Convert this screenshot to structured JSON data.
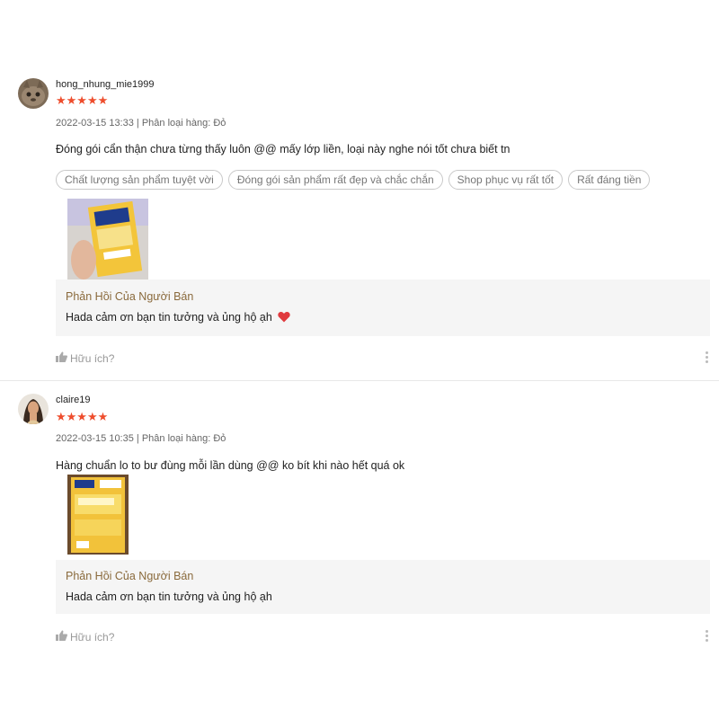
{
  "reviews": [
    {
      "username": "hong_nhung_mie1999",
      "stars": "★★★★★",
      "rating": 5,
      "meta": "2022-03-15 13:33 | Phân loại hàng: Đỏ",
      "comment": "Đóng gói cẩn thận chưa từng thấy luôn @@ mấy lớp liền, loại này nghe nói tốt chưa biết tn",
      "tags": [
        "Chất lượng sản phẩm tuyệt vời",
        "Đóng gói sản phẩm rất đẹp và chắc chắn",
        "Shop phục vụ rất tốt",
        "Rất đáng tiền"
      ],
      "reply_title": "Phản Hồi Của Người Bán",
      "reply_text": "Hada cảm ơn bạn tin tưởng và ủng hộ ạh",
      "helpful": "Hữu ích?"
    },
    {
      "username": "claire19",
      "stars": "★★★★★",
      "rating": 5,
      "meta": "2022-03-15 10:35 | Phân loại hàng: Đỏ",
      "comment": "Hàng chuẩn lo to bư đùng mỗi lần dùng @@ ko bít khi nào hết quá ok",
      "reply_title": "Phản Hồi Của Người Bán",
      "reply_text": "Hada cảm ơn bạn tin tưởng và ủng hộ ạh",
      "helpful": "Hữu ích?"
    }
  ],
  "colors": {
    "star": "#ee4d2d",
    "reply_title": "#8a6a3c",
    "heart": "#e03a3e"
  }
}
